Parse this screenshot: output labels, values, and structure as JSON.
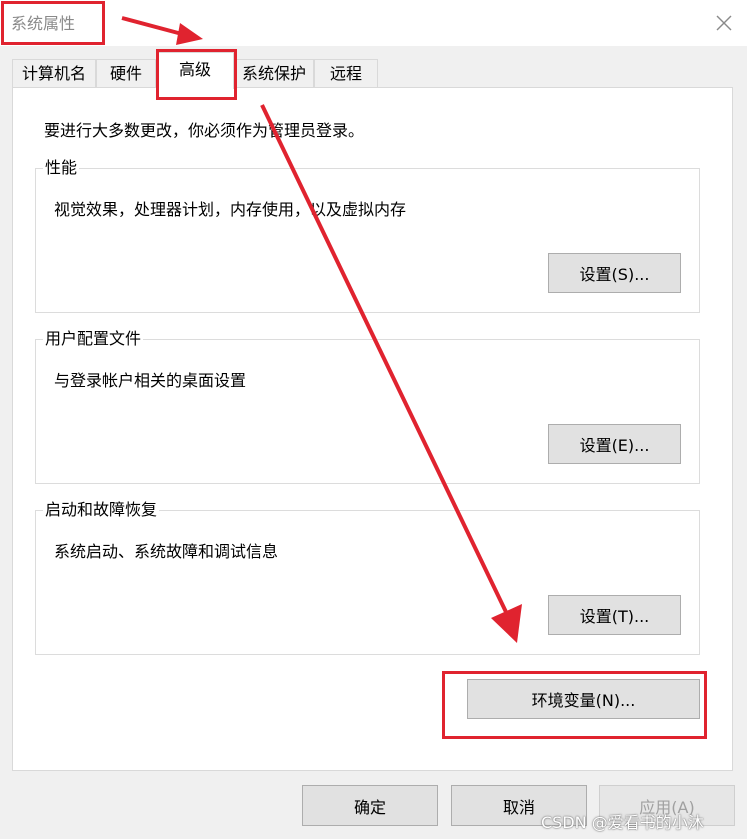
{
  "window": {
    "title": "系统属性"
  },
  "tabs": [
    {
      "label": "计算机名"
    },
    {
      "label": "硬件"
    },
    {
      "label": "高级",
      "active": true
    },
    {
      "label": "系统保护"
    },
    {
      "label": "远程"
    }
  ],
  "advanced": {
    "admin_notice": "要进行大多数更改，你必须作为管理员登录。",
    "performance": {
      "title": "性能",
      "description": "视觉效果，处理器计划，内存使用，以及虚拟内存",
      "button": "设置(S)..."
    },
    "user_profiles": {
      "title": "用户配置文件",
      "description": "与登录帐户相关的桌面设置",
      "button": "设置(E)..."
    },
    "startup_recovery": {
      "title": "启动和故障恢复",
      "description": "系统启动、系统故障和调试信息",
      "button": "设置(T)..."
    },
    "env_button": "环境变量(N)..."
  },
  "footer": {
    "ok": "确定",
    "cancel": "取消",
    "apply": "应用(A)"
  },
  "watermark": "CSDN @爱看书的小沐",
  "annotation_color": "#e0232f"
}
